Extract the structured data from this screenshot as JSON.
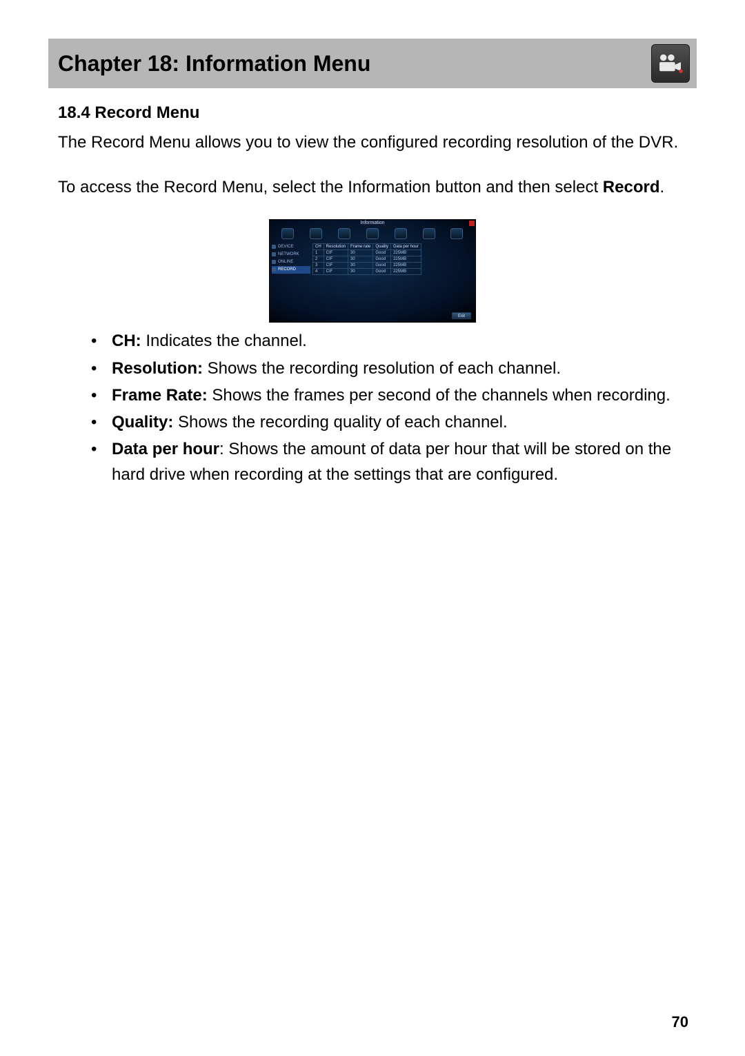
{
  "header": {
    "chapter_title": "Chapter 18: Information Menu",
    "icon_name": "camera-reel-icon"
  },
  "section": {
    "number_title": "18.4 Record Menu",
    "intro": "The Record Menu allows you to view the configured recording resolution of the DVR.",
    "access_pre": "To access the Record Menu, select the Information button and then select ",
    "access_bold": "Record",
    "access_post": "."
  },
  "screenshot": {
    "window_title": "Information",
    "sidebar": [
      "DEVICE",
      "NETWORK",
      "ONLINE",
      "RECORD"
    ],
    "columns": [
      "CH",
      "Resolution",
      "Frame rate",
      "Quality",
      "Data per hour"
    ],
    "rows": [
      {
        "ch": "1",
        "res": "CIF",
        "fr": "30",
        "q": "Good",
        "dph": "225MB"
      },
      {
        "ch": "2",
        "res": "CIF",
        "fr": "30",
        "q": "Good",
        "dph": "225MB"
      },
      {
        "ch": "3",
        "res": "CIF",
        "fr": "30",
        "q": "Good",
        "dph": "225MB"
      },
      {
        "ch": "4",
        "res": "CIF",
        "fr": "30",
        "q": "Good",
        "dph": "225MB"
      }
    ],
    "exit_label": "Exit"
  },
  "bullets": [
    {
      "term": "CH:",
      "desc": " Indicates the channel."
    },
    {
      "term": "Resolution:",
      "desc": " Shows the recording resolution of each channel."
    },
    {
      "term": "Frame Rate:",
      "desc": " Shows the frames per second of the channels when recording."
    },
    {
      "term": "Quality:",
      "desc": " Shows the recording quality of each channel."
    },
    {
      "term": "Data per hour",
      "desc": ": Shows the amount of data per hour that will be stored on the hard drive when recording at the settings that are configured."
    }
  ],
  "page_number": "70"
}
